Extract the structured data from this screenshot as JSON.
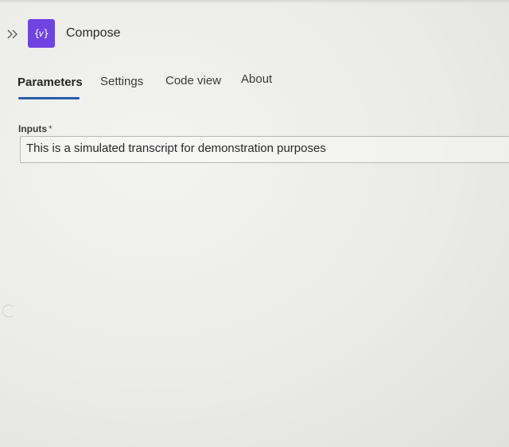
{
  "header": {
    "expand_icon": "double-chevron-right-icon",
    "action_icon": "variable-braces-icon",
    "action_icon_glyph": "{𝑣}",
    "title": "Compose",
    "accent_color": "#6f43e0"
  },
  "tabs": [
    {
      "label": "Parameters",
      "active": true
    },
    {
      "label": "Settings",
      "active": false
    },
    {
      "label": "Code view",
      "active": false
    },
    {
      "label": "About",
      "active": false
    }
  ],
  "tab_indicator_color": "#2b5aa6",
  "form": {
    "inputs_label": "Inputs",
    "required_mark": "*",
    "inputs_value": "This is a simulated transcript for demonstration purposes"
  }
}
